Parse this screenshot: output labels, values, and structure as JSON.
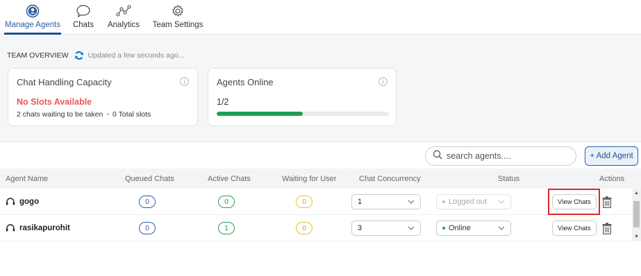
{
  "nav": {
    "items": [
      {
        "label": "Manage Agents",
        "icon": "user-circle-icon",
        "active": true
      },
      {
        "label": "Chats",
        "icon": "chat-bubble-icon",
        "active": false
      },
      {
        "label": "Analytics",
        "icon": "analytics-icon",
        "active": false
      },
      {
        "label": "Team Settings",
        "icon": "gear-icon",
        "active": false
      }
    ]
  },
  "overview": {
    "title": "TEAM OVERVIEW",
    "updated": "Updated a few seconds ago..."
  },
  "capacity_card": {
    "title": "Chat Handling Capacity",
    "status": "No Slots Available",
    "waiting": "2 chats waiting to be taken",
    "separator": "•",
    "total": "0 Total slots"
  },
  "online_card": {
    "title": "Agents Online",
    "value": "1/2",
    "progress_fraction": 0.5
  },
  "toolbar": {
    "search_placeholder": "search agents....",
    "add_agent_label": "+ Add Agent"
  },
  "table": {
    "headers": [
      "Agent Name",
      "Queued Chats",
      "Active Chats",
      "Waiting for User",
      "Chat Concurrency",
      "Status",
      "Actions"
    ],
    "rows": [
      {
        "name": "gogo",
        "queued": "0",
        "active": "0",
        "waiting": "0",
        "concurrency": "1",
        "status": "Logged out",
        "action": "View Chats"
      },
      {
        "name": "rasikapurohit",
        "queued": "0",
        "active": "1",
        "waiting": "0",
        "concurrency": "3",
        "status": "Online",
        "action": "View Chats"
      }
    ]
  },
  "colors": {
    "accent": "#1f4f93",
    "no_slots": "#e8595a",
    "online": "#2e9c55",
    "waiting": "#eabf2e",
    "highlight": "#e0262a"
  }
}
